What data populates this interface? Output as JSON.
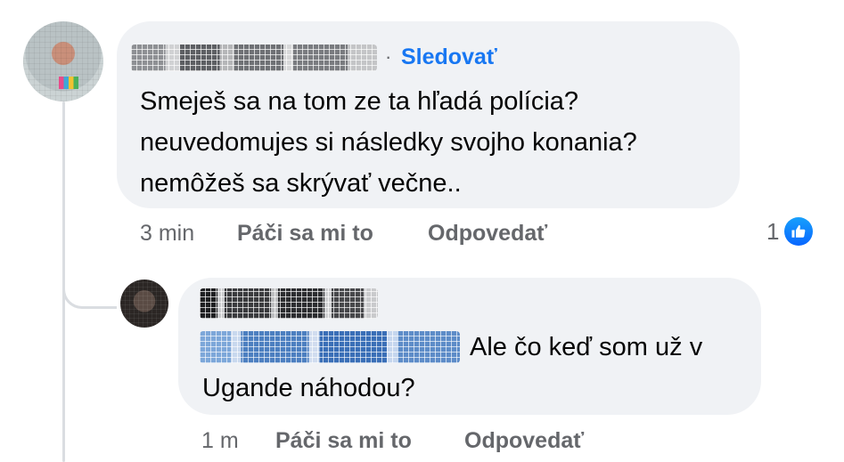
{
  "comments": [
    {
      "follow_label": "Sledovať",
      "text_lines": [
        "Smeješ sa na tom ze ta hľadá polícia?",
        "neuvedomujes si následky svojho konania?",
        "nemôžeš sa skrývať večne.."
      ],
      "time": "3 min",
      "like_label": "Páči sa mi to",
      "reply_label": "Odpovedať",
      "reaction_count": "1",
      "reaction_icon": "thumbs-up-icon"
    }
  ],
  "reply": {
    "text_line_1": "Ale čo keď som už v",
    "text_line_2": "Ugande náhodou?",
    "time": "1 m",
    "like_label": "Páči sa mi to",
    "reply_label": "Odpovedať"
  },
  "colors": {
    "link": "#1877f2",
    "bubble": "#f0f2f5",
    "meta": "#65676b",
    "like_badge": "#0866ff"
  }
}
